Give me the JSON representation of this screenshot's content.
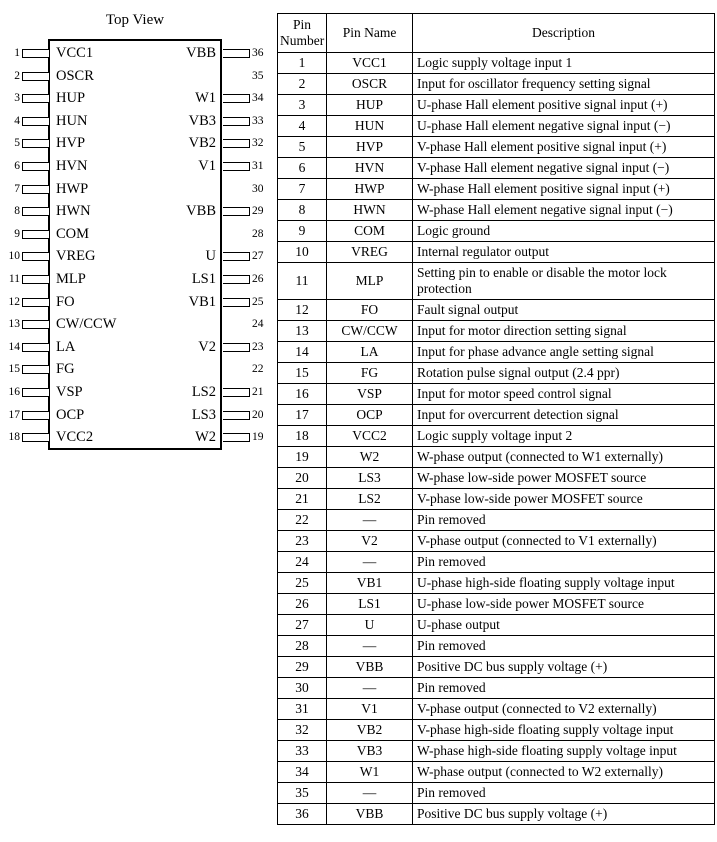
{
  "diagram": {
    "title": "Top View",
    "left_pins": [
      {
        "number": "1",
        "name": "VCC1",
        "lead": true
      },
      {
        "number": "2",
        "name": "OSCR",
        "lead": true
      },
      {
        "number": "3",
        "name": "HUP",
        "lead": true
      },
      {
        "number": "4",
        "name": "HUN",
        "lead": true
      },
      {
        "number": "5",
        "name": "HVP",
        "lead": true
      },
      {
        "number": "6",
        "name": "HVN",
        "lead": true
      },
      {
        "number": "7",
        "name": "HWP",
        "lead": true
      },
      {
        "number": "8",
        "name": "HWN",
        "lead": true
      },
      {
        "number": "9",
        "name": "COM",
        "lead": true
      },
      {
        "number": "10",
        "name": "VREG",
        "lead": true
      },
      {
        "number": "11",
        "name": "MLP",
        "lead": true
      },
      {
        "number": "12",
        "name": "FO",
        "lead": true
      },
      {
        "number": "13",
        "name": "CW/CCW",
        "lead": true
      },
      {
        "number": "14",
        "name": "LA",
        "lead": true
      },
      {
        "number": "15",
        "name": "FG",
        "lead": true
      },
      {
        "number": "16",
        "name": "VSP",
        "lead": true
      },
      {
        "number": "17",
        "name": "OCP",
        "lead": true
      },
      {
        "number": "18",
        "name": "VCC2",
        "lead": true
      }
    ],
    "right_pins": [
      {
        "number": "36",
        "name": "VBB",
        "lead": true
      },
      {
        "number": "35",
        "name": "",
        "lead": false
      },
      {
        "number": "34",
        "name": "W1",
        "lead": true
      },
      {
        "number": "33",
        "name": "VB3",
        "lead": true
      },
      {
        "number": "32",
        "name": "VB2",
        "lead": true
      },
      {
        "number": "31",
        "name": "V1",
        "lead": true
      },
      {
        "number": "30",
        "name": "",
        "lead": false
      },
      {
        "number": "29",
        "name": "VBB",
        "lead": true
      },
      {
        "number": "28",
        "name": "",
        "lead": false
      },
      {
        "number": "27",
        "name": "U",
        "lead": true
      },
      {
        "number": "26",
        "name": "LS1",
        "lead": true
      },
      {
        "number": "25",
        "name": "VB1",
        "lead": true
      },
      {
        "number": "24",
        "name": "",
        "lead": false
      },
      {
        "number": "23",
        "name": "V2",
        "lead": true
      },
      {
        "number": "22",
        "name": "",
        "lead": false
      },
      {
        "number": "21",
        "name": "LS2",
        "lead": true
      },
      {
        "number": "20",
        "name": "LS3",
        "lead": true
      },
      {
        "number": "19",
        "name": "W2",
        "lead": true
      }
    ]
  },
  "table": {
    "headers": {
      "pin_number": "Pin Number",
      "pin_number_line1": "Pin",
      "pin_number_line2": "Number",
      "pin_name": "Pin Name",
      "description": "Description"
    },
    "rows": [
      {
        "number": "1",
        "name": "VCC1",
        "description": "Logic supply voltage input 1"
      },
      {
        "number": "2",
        "name": "OSCR",
        "description": "Input for oscillator frequency setting signal"
      },
      {
        "number": "3",
        "name": "HUP",
        "description": "U-phase Hall element positive signal input (+)"
      },
      {
        "number": "4",
        "name": "HUN",
        "description": "U-phase Hall element negative signal input (−)"
      },
      {
        "number": "5",
        "name": "HVP",
        "description": "V-phase Hall element positive signal input (+)"
      },
      {
        "number": "6",
        "name": "HVN",
        "description": "V-phase Hall element negative signal input (−)"
      },
      {
        "number": "7",
        "name": "HWP",
        "description": "W-phase Hall element positive signal input (+)"
      },
      {
        "number": "8",
        "name": "HWN",
        "description": "W-phase Hall element negative signal input (−)"
      },
      {
        "number": "9",
        "name": "COM",
        "description": "Logic ground"
      },
      {
        "number": "10",
        "name": "VREG",
        "description": "Internal regulator output"
      },
      {
        "number": "11",
        "name": "MLP",
        "description": "Setting pin to enable or disable the motor lock protection",
        "tall": true
      },
      {
        "number": "12",
        "name": "FO",
        "description": "Fault signal output"
      },
      {
        "number": "13",
        "name": "CW/CCW",
        "description": "Input for motor direction setting signal"
      },
      {
        "number": "14",
        "name": "LA",
        "description": "Input for phase advance angle setting signal"
      },
      {
        "number": "15",
        "name": "FG",
        "description": "Rotation pulse signal output (2.4 ppr)"
      },
      {
        "number": "16",
        "name": "VSP",
        "description": "Input for motor speed control signal"
      },
      {
        "number": "17",
        "name": "OCP",
        "description": "Input for overcurrent detection signal"
      },
      {
        "number": "18",
        "name": "VCC2",
        "description": "Logic supply voltage input 2"
      },
      {
        "number": "19",
        "name": "W2",
        "description": "W-phase output (connected to W1 externally)"
      },
      {
        "number": "20",
        "name": "LS3",
        "description": "W-phase low-side power MOSFET source"
      },
      {
        "number": "21",
        "name": "LS2",
        "description": "V-phase low-side power MOSFET source"
      },
      {
        "number": "22",
        "name": "—",
        "description": "Pin removed"
      },
      {
        "number": "23",
        "name": "V2",
        "description": "V-phase output (connected to V1 externally)"
      },
      {
        "number": "24",
        "name": "—",
        "description": "Pin removed"
      },
      {
        "number": "25",
        "name": "VB1",
        "description": "U-phase high-side floating supply voltage input"
      },
      {
        "number": "26",
        "name": "LS1",
        "description": "U-phase low-side power MOSFET source"
      },
      {
        "number": "27",
        "name": "U",
        "description": "U-phase output"
      },
      {
        "number": "28",
        "name": "—",
        "description": "Pin removed"
      },
      {
        "number": "29",
        "name": "VBB",
        "description": "Positive DC bus supply voltage (+)"
      },
      {
        "number": "30",
        "name": "—",
        "description": "Pin removed"
      },
      {
        "number": "31",
        "name": "V1",
        "description": "V-phase output (connected to V2 externally)"
      },
      {
        "number": "32",
        "name": "VB2",
        "description": "V-phase high-side floating supply voltage input"
      },
      {
        "number": "33",
        "name": "VB3",
        "description": "W-phase high-side floating supply voltage input",
        "tall": true
      },
      {
        "number": "34",
        "name": "W1",
        "description": "W-phase output (connected to W2 externally)"
      },
      {
        "number": "35",
        "name": "—",
        "description": "Pin removed"
      },
      {
        "number": "36",
        "name": "VBB",
        "description": "Positive DC bus supply voltage (+)"
      }
    ]
  }
}
